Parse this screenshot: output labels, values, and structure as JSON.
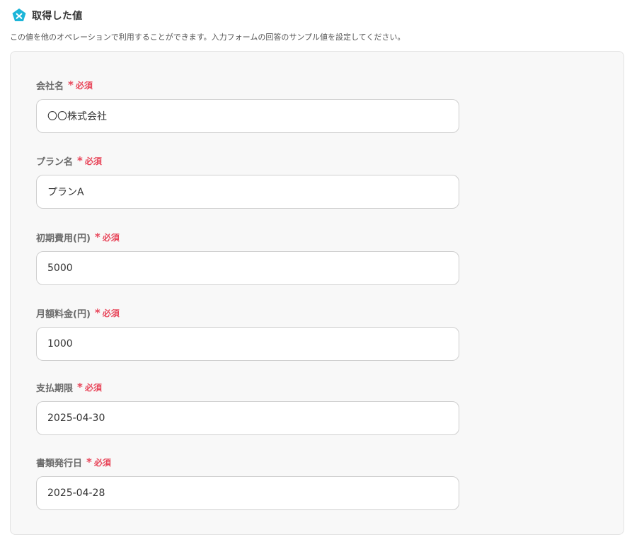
{
  "header": {
    "icon": "app-badge-icon",
    "title": "取得した値",
    "accent_color": "#1cb5d8"
  },
  "description": "この値を他のオペレーションで利用することができます。入力フォームの回答のサンプル値を設定してください。",
  "required_mark": "*",
  "required_text": "必須",
  "colors": {
    "required": "#e8475b",
    "panel_bg": "#f8f8f8",
    "border": "#cfcfcf"
  },
  "fields": [
    {
      "label": "会社名",
      "value": "〇〇株式会社"
    },
    {
      "label": "プラン名",
      "value": "プランA"
    },
    {
      "label": "初期費用(円)",
      "value": "5000"
    },
    {
      "label": "月額料金(円)",
      "value": "1000"
    },
    {
      "label": "支払期限",
      "value": "2025-04-30"
    },
    {
      "label": "書類発行日",
      "value": "2025-04-28"
    }
  ]
}
